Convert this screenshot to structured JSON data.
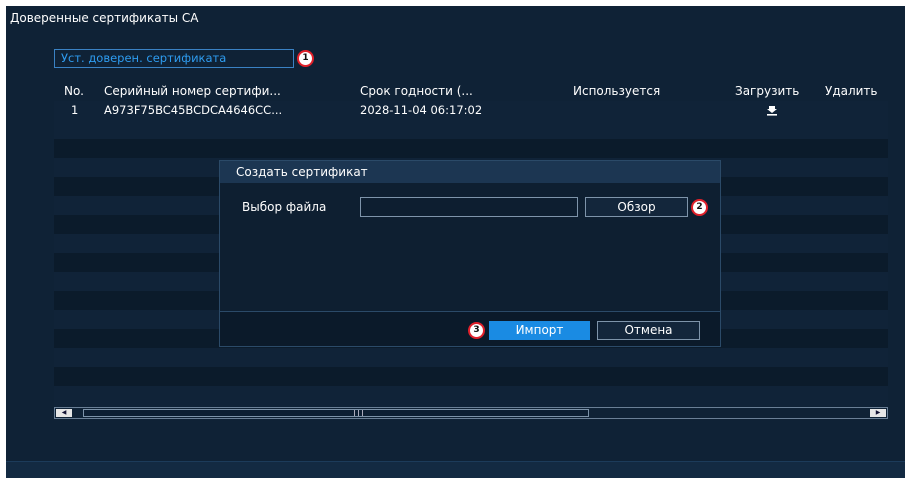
{
  "window": {
    "title": "Доверенные сертификаты CA"
  },
  "toolbar": {
    "add_label": "Уст. доверен. сертификата",
    "badge": "1"
  },
  "table": {
    "headers": {
      "no": "No.",
      "serial": "Серийный номер сертифи...",
      "expiry": "Срок годности (...",
      "used": "Используется",
      "download": "Загрузить",
      "delete": "Удалить"
    },
    "rows": [
      {
        "no": "1",
        "serial": "A973F75BC45BCDCA4646CC...",
        "expiry": "2028-11-04 06:17:02",
        "used": "",
        "download_icon": "download-icon"
      }
    ]
  },
  "dialog": {
    "title": "Создать сертификат",
    "file_label": "Выбор файла",
    "file_value": "",
    "browse_label": "Обзор",
    "browse_badge": "2",
    "import_label": "Импорт",
    "import_badge": "3",
    "cancel_label": "Отмена"
  },
  "colors": {
    "accent": "#1a8be3",
    "link": "#2e9cf0",
    "badge_border": "#e0202a",
    "window_bg": "#0f2236"
  }
}
